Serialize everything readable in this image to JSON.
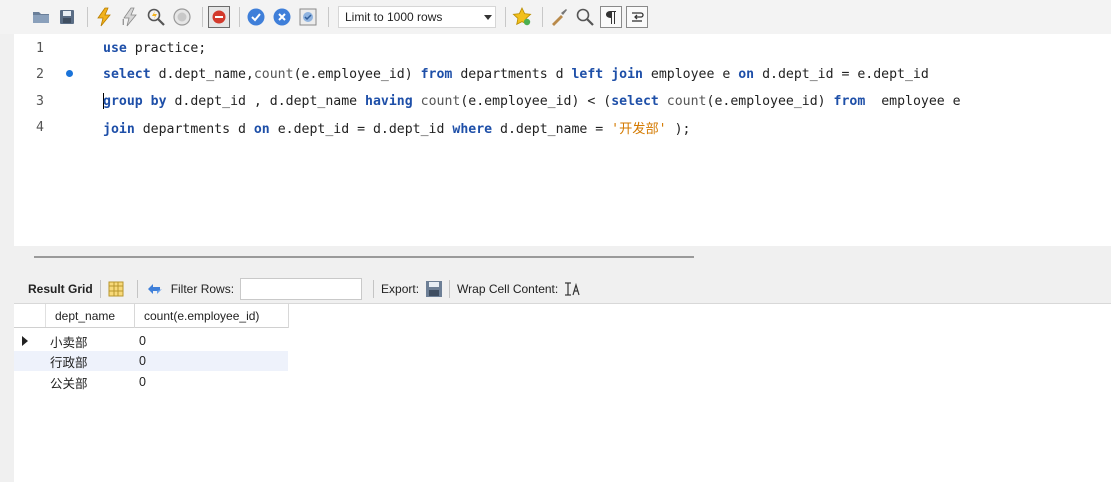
{
  "toolbar": {
    "limit_select": {
      "value": "Limit to 1000 rows"
    },
    "icons": [
      "open-folder-icon",
      "save-icon",
      "execute-icon",
      "execute-current-icon",
      "explain-icon",
      "stop-icon",
      "toggle-error-icon",
      "commit-icon",
      "rollback-icon",
      "autocommit-icon",
      "star-icon",
      "beautify-icon",
      "find-icon",
      "invisible-chars-icon",
      "wrap-icon"
    ]
  },
  "editor": {
    "lines": [
      {
        "num": "1"
      },
      {
        "num": "2"
      },
      {
        "num": "3"
      },
      {
        "num": "4"
      }
    ],
    "tokens": {
      "l1_use": "use",
      "l1_rest": " practice;",
      "l2_select": "select",
      "l2_a": " d.dept_name,",
      "l2_count": "count",
      "l2_b": "(e.employee_id) ",
      "l2_from": "from",
      "l2_c": " departments d ",
      "l2_left": "left",
      "l2_d": " ",
      "l2_join": "join",
      "l2_e": " employee e ",
      "l2_on": "on",
      "l2_f": " d.dept_id = e.dept_id",
      "l3_group": "group",
      "l3_a": " ",
      "l3_by": "by",
      "l3_b": " d.dept_id , d.dept_name ",
      "l3_having": "having",
      "l3_c": " ",
      "l3_count": "count",
      "l3_d": "(e.employee_id) < (",
      "l3_select": "select",
      "l3_e": " ",
      "l3_count2": "count",
      "l3_f": "(e.employee_id) ",
      "l3_from": "from",
      "l3_g": "  employee e",
      "l4_join": "join",
      "l4_a": " departments d ",
      "l4_on": "on",
      "l4_b": " e.dept_id = d.dept_id ",
      "l4_where": "where",
      "l4_c": " d.dept_name = ",
      "l4_str": "'开发部'",
      "l4_d": " );"
    }
  },
  "result_toolbar": {
    "title": "Result Grid",
    "filter_label": "Filter Rows:",
    "filter_value": "",
    "export_label": "Export:",
    "wrap_label": "Wrap Cell Content:"
  },
  "grid": {
    "columns": [
      "dept_name",
      "count(e.employee_id)"
    ],
    "rows": [
      [
        "小卖部",
        "0"
      ],
      [
        "行政部",
        "0"
      ],
      [
        "公关部",
        "0"
      ]
    ]
  },
  "colors": {
    "keyword": "#1e4fa8",
    "string": "#d47a00",
    "breakpoint_dot": "#1a73d9"
  }
}
